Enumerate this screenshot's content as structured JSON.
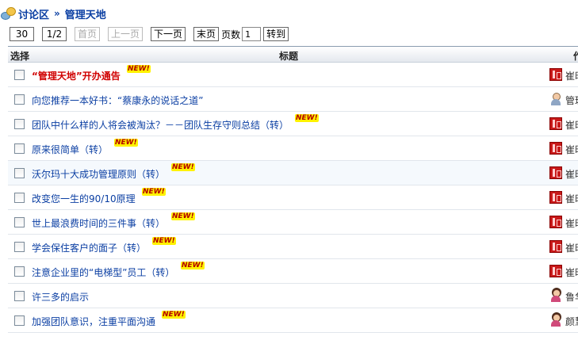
{
  "breadcrumb": {
    "root_label": "讨论区",
    "separator": "»",
    "current_label": "管理天地"
  },
  "pager": {
    "page_size": "30",
    "page_status": "1/2",
    "first_label": "首页",
    "prev_label": "上一页",
    "next_label": "下一页",
    "last_label": "末页",
    "page_num_label": "页数",
    "page_input_value": "1",
    "go_label": "转到"
  },
  "table": {
    "headers": {
      "select": "选择",
      "title": "标题",
      "author": "作"
    },
    "new_tag": "NEW!",
    "rows": [
      {
        "title": "“管理天地”开办通告",
        "hot": true,
        "new": true,
        "avatar": "seal",
        "author": "崔时"
      },
      {
        "title": "向您推荐一本好书：“蔡康永的说话之道”",
        "hot": false,
        "new": false,
        "avatar": "person",
        "author": "管理"
      },
      {
        "title": "团队中什么样的人将会被淘汰？－－团队生存守则总结（转）",
        "hot": false,
        "new": true,
        "avatar": "seal",
        "author": "崔时"
      },
      {
        "title": "原来很简单（转）",
        "hot": false,
        "new": true,
        "avatar": "seal",
        "author": "崔时"
      },
      {
        "title": "沃尔玛十大成功管理原则（转）",
        "hot": false,
        "new": true,
        "avatar": "seal",
        "author": "崔时"
      },
      {
        "title": "改变您一生的90/10原理",
        "hot": false,
        "new": true,
        "avatar": "seal",
        "author": "崔时"
      },
      {
        "title": "世上最浪费时间的三件事（转）",
        "hot": false,
        "new": true,
        "avatar": "seal",
        "author": "崔时"
      },
      {
        "title": "学会保住客户的面子（转）",
        "hot": false,
        "new": true,
        "avatar": "seal",
        "author": "崔时"
      },
      {
        "title": "注意企业里的“电梯型”员工（转）",
        "hot": false,
        "new": true,
        "avatar": "seal",
        "author": "崔时"
      },
      {
        "title": "许三多的启示",
        "hot": false,
        "new": false,
        "avatar": "female",
        "author": "鲁华"
      },
      {
        "title": "加强团队意识，注重平面沟通",
        "hot": false,
        "new": true,
        "avatar": "female",
        "author": "颜慧"
      }
    ]
  },
  "colors": {
    "link": "#0b3fa3",
    "hot": "#d00000",
    "new_bg": "#fff200"
  }
}
